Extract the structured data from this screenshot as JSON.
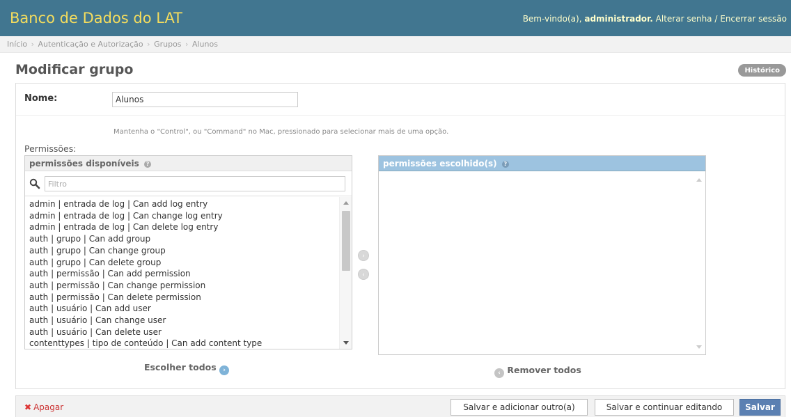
{
  "header": {
    "site_name": "Banco de Dados do LAT",
    "welcome": "Bem-vindo(a),",
    "username": "administrador.",
    "change_password": "Alterar senha",
    "separator": "/",
    "logout": "Encerrar sessão"
  },
  "breadcrumbs": [
    "Início",
    "Autenticação e Autorização",
    "Grupos",
    "Alunos"
  ],
  "breadcrumb_sep": "›",
  "page": {
    "title": "Modificar grupo",
    "history_button": "Histórico"
  },
  "form": {
    "name_label": "Nome:",
    "name_value": "Alunos",
    "help_text": "Mantenha o \"Control\", ou \"Command\" no Mac, pressionado para selecionar mais de uma opção.",
    "permissions_label": "Permissões:",
    "available_title": "permissões disponíveis",
    "chosen_title": "permissões escolhido(s)",
    "help_icon": "?",
    "filter_placeholder": "Filtro",
    "available_items": [
      "admin | entrada de log | Can add log entry",
      "admin | entrada de log | Can change log entry",
      "admin | entrada de log | Can delete log entry",
      "auth | grupo | Can add group",
      "auth | grupo | Can change group",
      "auth | grupo | Can delete group",
      "auth | permissão | Can add permission",
      "auth | permissão | Can change permission",
      "auth | permissão | Can delete permission",
      "auth | usuário | Can add user",
      "auth | usuário | Can change user",
      "auth | usuário | Can delete user",
      "contenttypes | tipo de conteúdo | Can add content type"
    ],
    "chosen_items": [],
    "choose_all": "Escolher todos",
    "remove_all": "Remover todos"
  },
  "submit_row": {
    "delete": "Apagar",
    "save_add_another": "Salvar e adicionar outro(a)",
    "save_continue": "Salvar e continuar editando",
    "save": "Salvar"
  },
  "colors": {
    "header_bg": "#417690",
    "site_name": "#f5dd5d",
    "chosen_header": "#9dc3e0",
    "save_button": "#5b80b2",
    "delete_link": "#cc3434"
  },
  "icons": [
    "search-icon",
    "help-icon",
    "add-arrow-icon",
    "remove-arrow-icon",
    "delete-x-icon"
  ]
}
